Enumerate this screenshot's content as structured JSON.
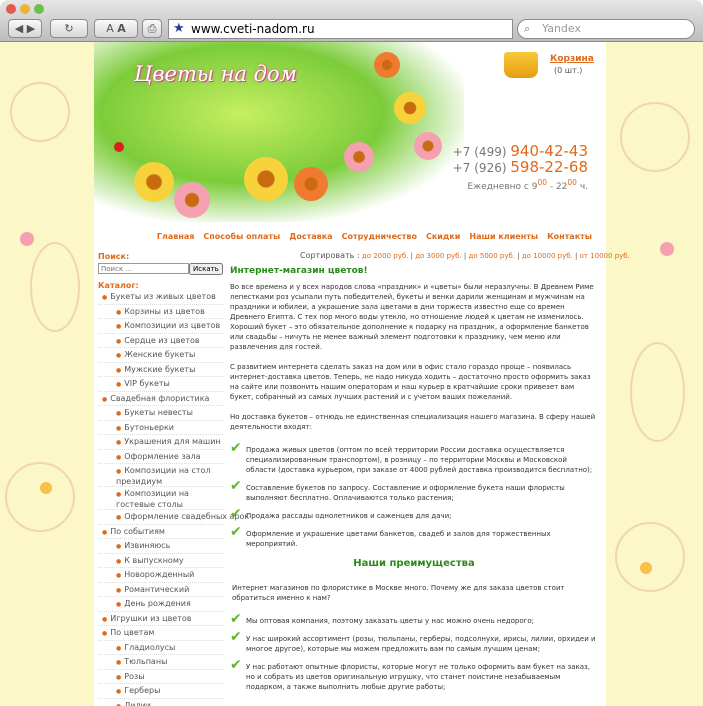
{
  "browser": {
    "url": "www.cveti-nadom.ru",
    "search_placeholder": "Yandex",
    "font_button": "A",
    "colors": {
      "chrome": "#d0d0d0",
      "accent": "#e06a1a",
      "green": "#2a8a1a"
    }
  },
  "header": {
    "logo": "Цветы на дом",
    "cart_label": "Корзина",
    "cart_count": "(0 шт.)",
    "phone1_code": "+7 (499)",
    "phone1_num": "940-42-43",
    "phone2_code": "+7 (926)",
    "phone2_num": "598-22-68",
    "hours_prefix": "Ежедневно с 9",
    "hours_from_sup": "00",
    "hours_mid": " - 22",
    "hours_to_sup": "00",
    "hours_suffix": " ч."
  },
  "nav": [
    "Главная",
    "Способы оплаты",
    "Доставка",
    "Сотрудничество",
    "Скидки",
    "Наши клиенты",
    "Контакты"
  ],
  "sidebar": {
    "search_title": "Поиск:",
    "search_placeholder": "Поиск ...",
    "search_button": "Искать",
    "catalog_title": "Каталог:",
    "items": [
      {
        "label": "Букеты из живых цветов",
        "level": "top"
      },
      {
        "label": "Корзины из цветов",
        "level": "sub"
      },
      {
        "label": "Композиции из цветов",
        "level": "sub"
      },
      {
        "label": "Сердце из цветов",
        "level": "sub"
      },
      {
        "label": "Женские букеты",
        "level": "sub"
      },
      {
        "label": "Мужские букеты",
        "level": "sub"
      },
      {
        "label": "VIP букеты",
        "level": "sub"
      },
      {
        "label": "Свадебная флористика",
        "level": "top"
      },
      {
        "label": "Букеты невесты",
        "level": "sub"
      },
      {
        "label": "Бутоньерки",
        "level": "sub"
      },
      {
        "label": "Украшения для машин",
        "level": "sub"
      },
      {
        "label": "Оформление зала",
        "level": "sub"
      },
      {
        "label": "Композиции на стол президиум",
        "level": "sub",
        "wrap": true
      },
      {
        "label": "Композиции на гостевые столы",
        "level": "sub",
        "wrap": true
      },
      {
        "label": "Оформление свадебных арок",
        "level": "sub"
      },
      {
        "label": "По событиям",
        "level": "top"
      },
      {
        "label": "Извиняюсь",
        "level": "sub"
      },
      {
        "label": "К выпускному",
        "level": "sub"
      },
      {
        "label": "Новорожденный",
        "level": "sub"
      },
      {
        "label": "Романтический",
        "level": "sub"
      },
      {
        "label": "День рождения",
        "level": "sub"
      },
      {
        "label": "Игрушки из цветов",
        "level": "top"
      },
      {
        "label": "По цветам",
        "level": "top"
      },
      {
        "label": "Гладиолусы",
        "level": "sub"
      },
      {
        "label": "Тюльпаны",
        "level": "sub"
      },
      {
        "label": "Розы",
        "level": "sub"
      },
      {
        "label": "Герберы",
        "level": "sub"
      },
      {
        "label": "Лилии",
        "level": "sub"
      }
    ]
  },
  "sort": {
    "label": "Сортировать :",
    "options": [
      "до 2000 руб.",
      "до 3000 руб.",
      "до 5000 руб.",
      "до 10000 руб.",
      "от 10000 руб."
    ]
  },
  "main": {
    "title": "Интернет-магазин цветов!",
    "p1": "Во все времена и у всех народов слова «праздник» и «цветы» были неразлучны. В Древнем Риме лепестками роз усыпали путь победителей, букеты и венки дарили женщинам и мужчинам на праздники и юбилеи, а украшение зала цветами в дни торжеств известно еще со времен Древнего Египта. С тех пор много воды утекло, но отношение людей к цветам не изменилось. Хороший букет – это обязательное дополнение к подарку на праздник, а оформление банкетов или свадьбы – ничуть не менее важный элемент подготовки к празднику, чем меню или развлечения для гостей.",
    "p2": "С развитием интернета сделать заказ на дом или в офис стало гораздо проще – появилась интернет-доставка цветов. Теперь, не надо никуда ходить – достаточно просто оформить заказ на сайте или позвонить нашим операторам и наш курьер в кратчайшие сроки привезет вам букет, собранный из самых лучших растений и с учетом ваших пожеланий.",
    "p3": "Но доставка букетов – отнюдь не единственная специализация нашего магазина. В сферу нашей деятельности входят:",
    "services": [
      "Продажа живых цветов (оптом по всей территории России доставка осуществляется специализированным транспортом), в розницу – по территории Москвы и Московской области (доставка курьером, при заказе от 4000 рублей доставка производится бесплатно);",
      "Составление букетов по запросу. Составление и оформление букета наши флористы выполняют бесплатно. Оплачиваются только растения;",
      "Продажа рассады однолетников и саженцев для дачи;",
      "Оформление и украшение цветами банкетов, свадеб и залов для торжественных мероприятий."
    ],
    "advantages_title": "Наши преимущества",
    "p4": "Интернет магазинов по флористике в Москве много. Почему же для заказа цветов стоит обратиться именно к нам?",
    "advantages": [
      "Мы оптовая компания, поэтому заказать цветы у нас можно очень недорого;",
      "У нас широкий ассортимент (розы, тюльпаны, герберы, подсолнухи, ирисы, лилии, орхидеи и многое другое), которые мы можем предложить вам по самым лучшим ценам;",
      "У нас работают опытные флористы, которые могут не только оформить вам букет на заказ, но и собрать из цветов оригинальную игрушку, что станет поистине незабываемым подарком, а также выполнить любые другие работы;"
    ]
  }
}
